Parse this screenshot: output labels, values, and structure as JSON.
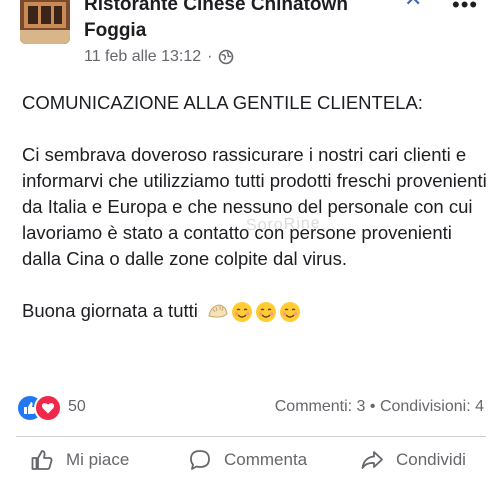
{
  "post": {
    "page_name": "Ristorante Cinese Chinatown Foggia",
    "timestamp": "11 feb alle 13:12",
    "separator": "·",
    "privacy_icon": "globe-icon",
    "headline": "COMUNICAZIONE ALLA GENTILE CLIENTELA:",
    "paragraph": "Ci sembrava doveroso rassicurare i nostri cari clienti e informarvi che utilizziamo tutti prodotti freschi provenienti da Italia e Europa e che nessuno del personale con cui lavoriamo è stato a contatto con persone provenienti dalla Cina o dalle zone colpite dal virus.",
    "closing": "Buona giornata a tutti",
    "closing_emojis": [
      "dumpling-emoji",
      "smiling-face-emoji",
      "smiling-face-emoji",
      "smiling-face-emoji"
    ],
    "watermark": "SoroRine"
  },
  "engagement": {
    "reaction_icons": [
      "like-icon",
      "love-icon"
    ],
    "reaction_count": "50",
    "comments_shares": "Commenti: 3 • Condivisioni: 4"
  },
  "actions": {
    "like_label": "Mi piace",
    "comment_label": "Commenta",
    "share_label": "Condividi"
  },
  "colors": {
    "text": "#1c1e21",
    "secondary_text": "#65676b",
    "like_blue": "#2078f4",
    "love_red": "#f0284a"
  }
}
